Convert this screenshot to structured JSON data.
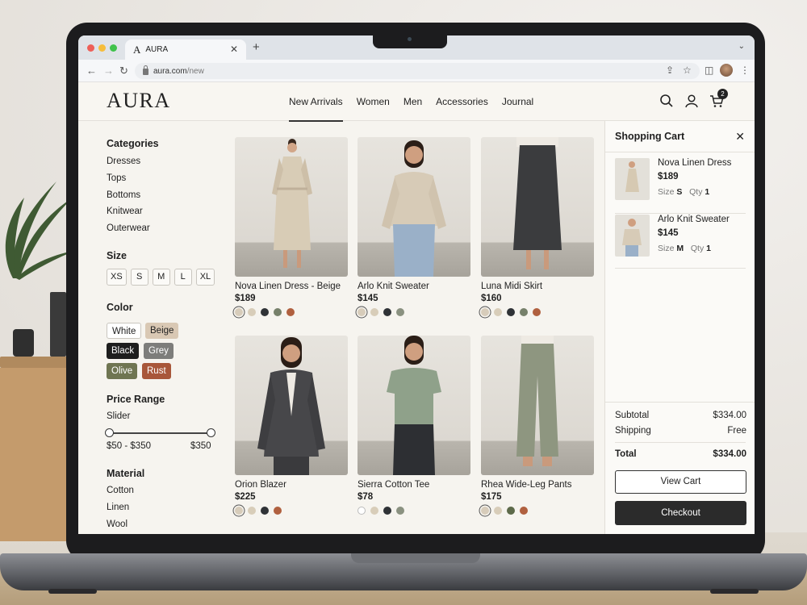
{
  "browser": {
    "tab_title": "AURA",
    "tab_favicon": "A",
    "url_domain": "aura.com",
    "url_path": "/new"
  },
  "header": {
    "logo": "AURA",
    "nav": [
      "New Arrivals",
      "Women",
      "Men",
      "Accessories",
      "Journal"
    ],
    "active_nav": "New Arrivals",
    "cart_count": "2"
  },
  "filters": {
    "categories_title": "Categories",
    "categories": [
      "Dresses",
      "Tops",
      "Bottoms",
      "Knitwear",
      "Outerwear"
    ],
    "size_title": "Size",
    "sizes": [
      "XS",
      "S",
      "M",
      "L",
      "XL"
    ],
    "color_title": "Color",
    "colors": [
      {
        "label": "White",
        "bg": "#ffffff",
        "fg": "#222222"
      },
      {
        "label": "Beige",
        "bg": "#d9c8b4",
        "fg": "#222222"
      },
      {
        "label": "Black",
        "bg": "#1e1e1e",
        "fg": "#ffffff"
      },
      {
        "label": "Grey",
        "bg": "#7d7d7b",
        "fg": "#ffffff"
      },
      {
        "label": "Olive",
        "bg": "#6f7552",
        "fg": "#ffffff"
      },
      {
        "label": "Rust",
        "bg": "#a8573a",
        "fg": "#ffffff"
      }
    ],
    "price_title": "Price Range",
    "slider_label": "Slider",
    "price_range": "$50 - $350",
    "price_max": "$350",
    "material_title": "Material",
    "materials": [
      "Cotton",
      "Linen",
      "Wool"
    ]
  },
  "products": [
    {
      "name": "Nova Linen Dress - Beige",
      "price": "$189",
      "swatches": [
        "#d7ccba",
        "#d8cdb9",
        "#2f3236",
        "#76806a",
        "#b0603f"
      ],
      "selected": 0
    },
    {
      "name": "Arlo Knit Sweater",
      "price": "$145",
      "swatches": [
        "#d7ccba",
        "#d8cdb9",
        "#2f3236",
        "#8a9180"
      ],
      "selected": 0
    },
    {
      "name": "Luna Midi Skirt",
      "price": "$160",
      "swatches": [
        "#d7ccba",
        "#d8cdb9",
        "#2f3236",
        "#76806a",
        "#b0603f"
      ],
      "selected": 0
    },
    {
      "name": "Orion Blazer",
      "price": "$225",
      "swatches": [
        "#d7ccba",
        "#d8cdb9",
        "#2f3236",
        "#b0603f"
      ],
      "selected": 0
    },
    {
      "name": "Sierra Cotton Tee",
      "price": "$78",
      "swatches": [
        "#ffffff",
        "#d8cdb9",
        "#2f3236",
        "#8a9180"
      ],
      "selected": -1
    },
    {
      "name": "Rhea Wide-Leg Pants",
      "price": "$175",
      "swatches": [
        "#d7ccba",
        "#d8cdb9",
        "#5d6a4a",
        "#b0603f"
      ],
      "selected": 0
    }
  ],
  "cart": {
    "title": "Shopping Cart",
    "items": [
      {
        "name": "Nova Linen Dress",
        "price": "$189",
        "size_label": "Size",
        "size": "S",
        "qty_label": "Qty",
        "qty": "1"
      },
      {
        "name": "Arlo Knit Sweater",
        "price": "$145",
        "size_label": "Size",
        "size": "M",
        "qty_label": "Qty",
        "qty": "1"
      }
    ],
    "subtotal_label": "Subtotal",
    "subtotal": "$334.00",
    "shipping_label": "Shipping",
    "shipping": "Free",
    "total_label": "Total",
    "total": "$334.00",
    "view_cart": "View Cart",
    "checkout": "Checkout"
  }
}
